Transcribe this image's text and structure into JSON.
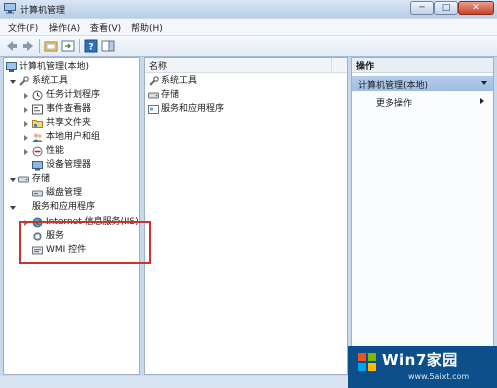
{
  "window": {
    "title": "计算机管理"
  },
  "titlebar_buttons": {
    "minimize": "─",
    "maximize": "□",
    "close": "✕"
  },
  "menubar": [
    "文件(F)",
    "操作(A)",
    "查看(V)",
    "帮助(H)"
  ],
  "toolbar_icons": [
    "back-arrow-icon",
    "forward-arrow-icon",
    "up-folder-icon",
    "show-hide-tree-icon",
    "help-icon",
    "action-pane-icon"
  ],
  "tree": {
    "root": "计算机管理(本地)",
    "system_tools": "系统工具",
    "task_scheduler": "任务计划程序",
    "event_viewer": "事件查看器",
    "shared_folders": "共享文件夹",
    "local_users": "本地用户和组",
    "performance": "性能",
    "device_manager": "设备管理器",
    "storage": "存储",
    "disk_management": "磁盘管理",
    "services_apps": "服务和应用程序",
    "iis": "Internet 信息服务(IIS)管",
    "services": "服务",
    "wmi": "WMI 控件"
  },
  "list": {
    "column_name": "名称",
    "items": [
      "系统工具",
      "存储",
      "服务和应用程序"
    ]
  },
  "actions": {
    "header": "操作",
    "selected": "计算机管理(本地)",
    "more": "更多操作"
  },
  "watermark": {
    "brand": "Win7家园",
    "url": "www.5aixt.com"
  },
  "colors": {
    "accent": "#0c4f8a",
    "highlight_box": "#d0322d",
    "selection": "#b4cdec"
  }
}
